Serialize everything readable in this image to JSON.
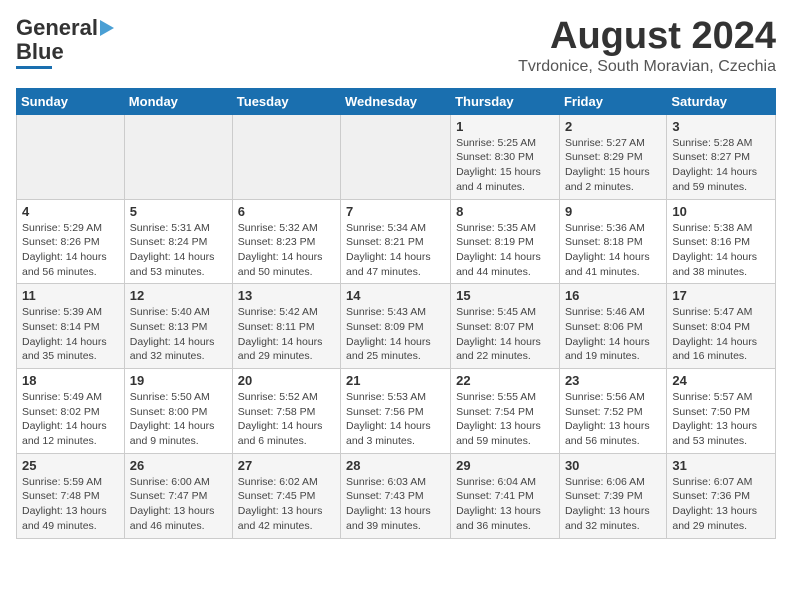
{
  "header": {
    "logo_general": "General",
    "logo_blue": "Blue",
    "title": "August 2024",
    "subtitle": "Tvrdonice, South Moravian, Czechia"
  },
  "weekdays": [
    "Sunday",
    "Monday",
    "Tuesday",
    "Wednesday",
    "Thursday",
    "Friday",
    "Saturday"
  ],
  "weeks": [
    [
      {
        "day": "",
        "detail": ""
      },
      {
        "day": "",
        "detail": ""
      },
      {
        "day": "",
        "detail": ""
      },
      {
        "day": "",
        "detail": ""
      },
      {
        "day": "1",
        "detail": "Sunrise: 5:25 AM\nSunset: 8:30 PM\nDaylight: 15 hours\nand 4 minutes."
      },
      {
        "day": "2",
        "detail": "Sunrise: 5:27 AM\nSunset: 8:29 PM\nDaylight: 15 hours\nand 2 minutes."
      },
      {
        "day": "3",
        "detail": "Sunrise: 5:28 AM\nSunset: 8:27 PM\nDaylight: 14 hours\nand 59 minutes."
      }
    ],
    [
      {
        "day": "4",
        "detail": "Sunrise: 5:29 AM\nSunset: 8:26 PM\nDaylight: 14 hours\nand 56 minutes."
      },
      {
        "day": "5",
        "detail": "Sunrise: 5:31 AM\nSunset: 8:24 PM\nDaylight: 14 hours\nand 53 minutes."
      },
      {
        "day": "6",
        "detail": "Sunrise: 5:32 AM\nSunset: 8:23 PM\nDaylight: 14 hours\nand 50 minutes."
      },
      {
        "day": "7",
        "detail": "Sunrise: 5:34 AM\nSunset: 8:21 PM\nDaylight: 14 hours\nand 47 minutes."
      },
      {
        "day": "8",
        "detail": "Sunrise: 5:35 AM\nSunset: 8:19 PM\nDaylight: 14 hours\nand 44 minutes."
      },
      {
        "day": "9",
        "detail": "Sunrise: 5:36 AM\nSunset: 8:18 PM\nDaylight: 14 hours\nand 41 minutes."
      },
      {
        "day": "10",
        "detail": "Sunrise: 5:38 AM\nSunset: 8:16 PM\nDaylight: 14 hours\nand 38 minutes."
      }
    ],
    [
      {
        "day": "11",
        "detail": "Sunrise: 5:39 AM\nSunset: 8:14 PM\nDaylight: 14 hours\nand 35 minutes."
      },
      {
        "day": "12",
        "detail": "Sunrise: 5:40 AM\nSunset: 8:13 PM\nDaylight: 14 hours\nand 32 minutes."
      },
      {
        "day": "13",
        "detail": "Sunrise: 5:42 AM\nSunset: 8:11 PM\nDaylight: 14 hours\nand 29 minutes."
      },
      {
        "day": "14",
        "detail": "Sunrise: 5:43 AM\nSunset: 8:09 PM\nDaylight: 14 hours\nand 25 minutes."
      },
      {
        "day": "15",
        "detail": "Sunrise: 5:45 AM\nSunset: 8:07 PM\nDaylight: 14 hours\nand 22 minutes."
      },
      {
        "day": "16",
        "detail": "Sunrise: 5:46 AM\nSunset: 8:06 PM\nDaylight: 14 hours\nand 19 minutes."
      },
      {
        "day": "17",
        "detail": "Sunrise: 5:47 AM\nSunset: 8:04 PM\nDaylight: 14 hours\nand 16 minutes."
      }
    ],
    [
      {
        "day": "18",
        "detail": "Sunrise: 5:49 AM\nSunset: 8:02 PM\nDaylight: 14 hours\nand 12 minutes."
      },
      {
        "day": "19",
        "detail": "Sunrise: 5:50 AM\nSunset: 8:00 PM\nDaylight: 14 hours\nand 9 minutes."
      },
      {
        "day": "20",
        "detail": "Sunrise: 5:52 AM\nSunset: 7:58 PM\nDaylight: 14 hours\nand 6 minutes."
      },
      {
        "day": "21",
        "detail": "Sunrise: 5:53 AM\nSunset: 7:56 PM\nDaylight: 14 hours\nand 3 minutes."
      },
      {
        "day": "22",
        "detail": "Sunrise: 5:55 AM\nSunset: 7:54 PM\nDaylight: 13 hours\nand 59 minutes."
      },
      {
        "day": "23",
        "detail": "Sunrise: 5:56 AM\nSunset: 7:52 PM\nDaylight: 13 hours\nand 56 minutes."
      },
      {
        "day": "24",
        "detail": "Sunrise: 5:57 AM\nSunset: 7:50 PM\nDaylight: 13 hours\nand 53 minutes."
      }
    ],
    [
      {
        "day": "25",
        "detail": "Sunrise: 5:59 AM\nSunset: 7:48 PM\nDaylight: 13 hours\nand 49 minutes."
      },
      {
        "day": "26",
        "detail": "Sunrise: 6:00 AM\nSunset: 7:47 PM\nDaylight: 13 hours\nand 46 minutes."
      },
      {
        "day": "27",
        "detail": "Sunrise: 6:02 AM\nSunset: 7:45 PM\nDaylight: 13 hours\nand 42 minutes."
      },
      {
        "day": "28",
        "detail": "Sunrise: 6:03 AM\nSunset: 7:43 PM\nDaylight: 13 hours\nand 39 minutes."
      },
      {
        "day": "29",
        "detail": "Sunrise: 6:04 AM\nSunset: 7:41 PM\nDaylight: 13 hours\nand 36 minutes."
      },
      {
        "day": "30",
        "detail": "Sunrise: 6:06 AM\nSunset: 7:39 PM\nDaylight: 13 hours\nand 32 minutes."
      },
      {
        "day": "31",
        "detail": "Sunrise: 6:07 AM\nSunset: 7:36 PM\nDaylight: 13 hours\nand 29 minutes."
      }
    ]
  ]
}
